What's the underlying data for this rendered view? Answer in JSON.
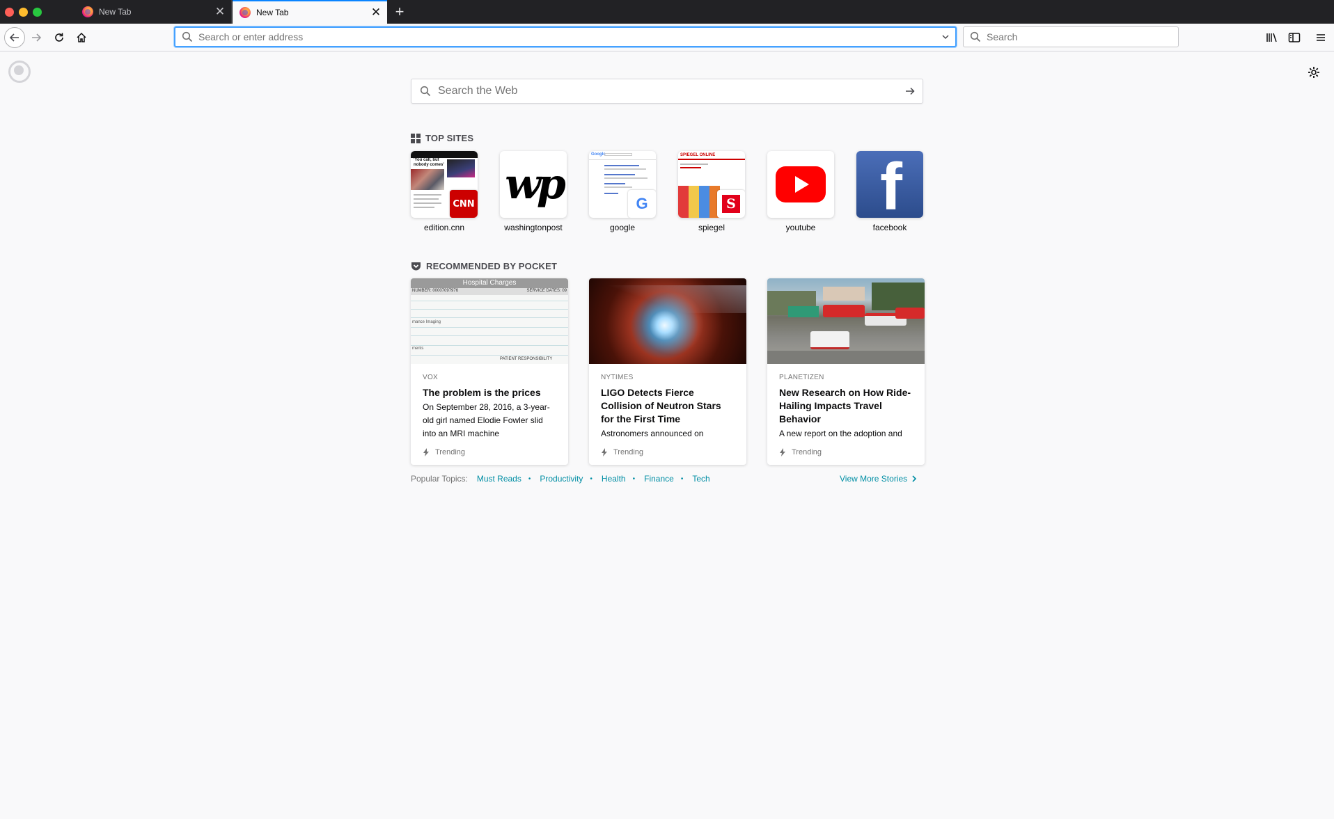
{
  "tabs": [
    {
      "title": "New Tab",
      "close": "✕"
    },
    {
      "title": "New Tab",
      "close": "✕"
    }
  ],
  "new_tab_symbol": "+",
  "toolbar": {
    "url_placeholder": "Search or enter address",
    "search_placeholder": "Search"
  },
  "page": {
    "web_search_placeholder": "Search the Web",
    "top_sites_title": "TOP SITES",
    "pocket_title": "RECOMMENDED BY POCKET",
    "top_sites": [
      {
        "label": "edition.cnn",
        "icon": "cnn-icon"
      },
      {
        "label": "washingtonpost",
        "icon": "washingtonpost-icon"
      },
      {
        "label": "google",
        "icon": "google-icon"
      },
      {
        "label": "spiegel",
        "icon": "spiegel-icon"
      },
      {
        "label": "youtube",
        "icon": "youtube-icon"
      },
      {
        "label": "facebook",
        "icon": "facebook-icon"
      }
    ],
    "cnn_tile": {
      "headline": "'You call, but nobody comes'",
      "logo": "CNN"
    },
    "wp_tile": {
      "logo": "wp"
    },
    "google_tile": {
      "logo": "G",
      "brand": "Google"
    },
    "spiegel_tile": {
      "logo": "S",
      "brand": "SPIEGEL ONLINE"
    },
    "facebook_tile": {
      "logo": "f"
    },
    "stories": [
      {
        "source": "VOX",
        "title": "The problem is the prices",
        "desc": "On September 28, 2016, a 3-year-old girl named Elodie Fowler slid into an MRI machine",
        "context": "Trending",
        "image_caption": "Hospital Charges",
        "image_service": "SERVICE DATES: 09",
        "image_number": "NUMBER: 00007097976",
        "image_row1": "mance Imaging",
        "image_row2": "ments",
        "image_footer": "PATIENT RESPONSIBILITY"
      },
      {
        "source": "NYTIMES",
        "title": "LIGO Detects Fierce Collision of Neutron Stars for the First Time",
        "desc": "Astronomers announced on",
        "context": "Trending"
      },
      {
        "source": "PLANETIZEN",
        "title": "New Research on How Ride-Hailing Impacts Travel Behavior",
        "desc": "A new report on the adoption and",
        "context": "Trending"
      }
    ],
    "popular_topics_label": "Popular Topics:",
    "topics": [
      "Must Reads",
      "Productivity",
      "Health",
      "Finance",
      "Tech"
    ],
    "view_more": "View More Stories"
  },
  "colors": {
    "accent": "#0a84ff",
    "link": "#008ea4",
    "youtube_red": "#ff0000",
    "facebook_blue": "#3b5998"
  }
}
